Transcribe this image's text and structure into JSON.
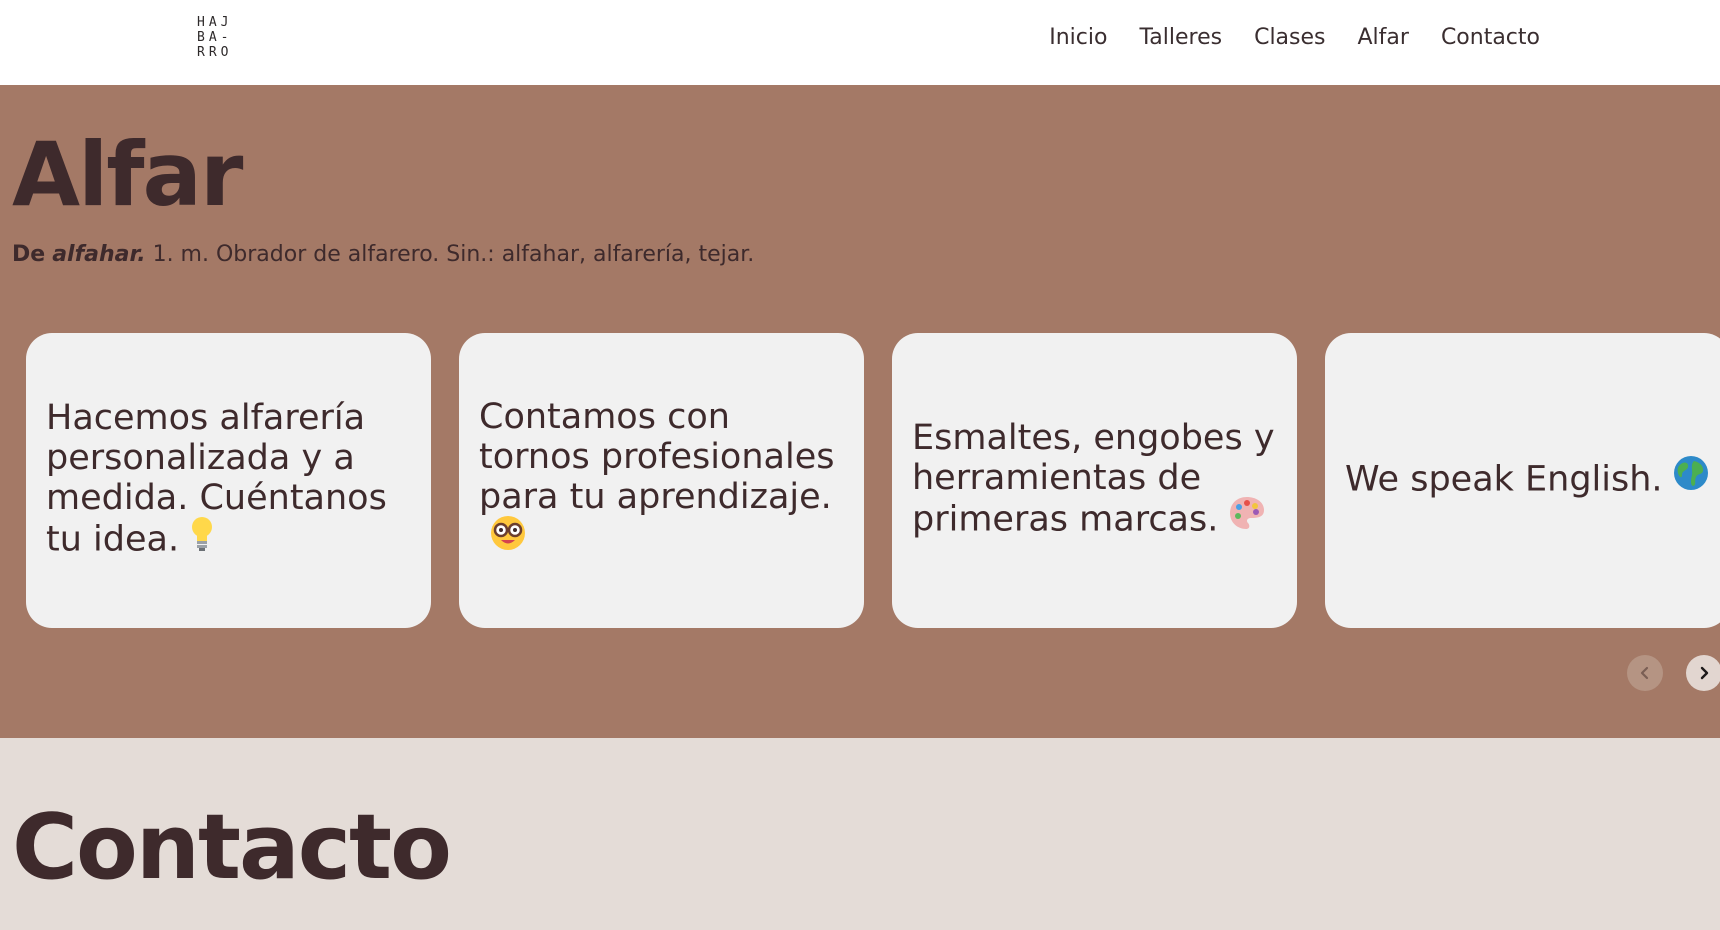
{
  "header": {
    "logo_lines": [
      "HAJ",
      "BA-",
      "RRO"
    ],
    "nav": [
      "Inicio",
      "Talleres",
      "Clases",
      "Alfar",
      "Contacto"
    ]
  },
  "alfar": {
    "title": "Alfar",
    "definition": {
      "prefix": "De",
      "word": "alfahar.",
      "text": " 1. m. Obrador de alfarero. Sin.: alfahar, alfarería, tejar."
    },
    "cards": [
      {
        "text": "Hacemos alfarería personalizada y a medida. Cuéntanos tu idea.",
        "icon": "light-bulb-icon"
      },
      {
        "text": "Contamos con tornos profesionales para tu aprendizaje.",
        "icon": "nerd-face-icon"
      },
      {
        "text": "Esmaltes, engobes y herramientas de primeras marcas.",
        "icon": "artist-palette-icon"
      },
      {
        "text": "We speak English.",
        "icon": "globe-icon"
      }
    ],
    "carousel": {
      "prev_icon": "chevron-left-icon",
      "next_icon": "chevron-right-icon"
    }
  },
  "contacto": {
    "title": "Contacto"
  },
  "colors": {
    "alfar_bg": "#a47966",
    "contacto_bg": "#e4dcd7",
    "card_bg": "#f1f1f1",
    "text_dark": "#3e2a2c"
  }
}
